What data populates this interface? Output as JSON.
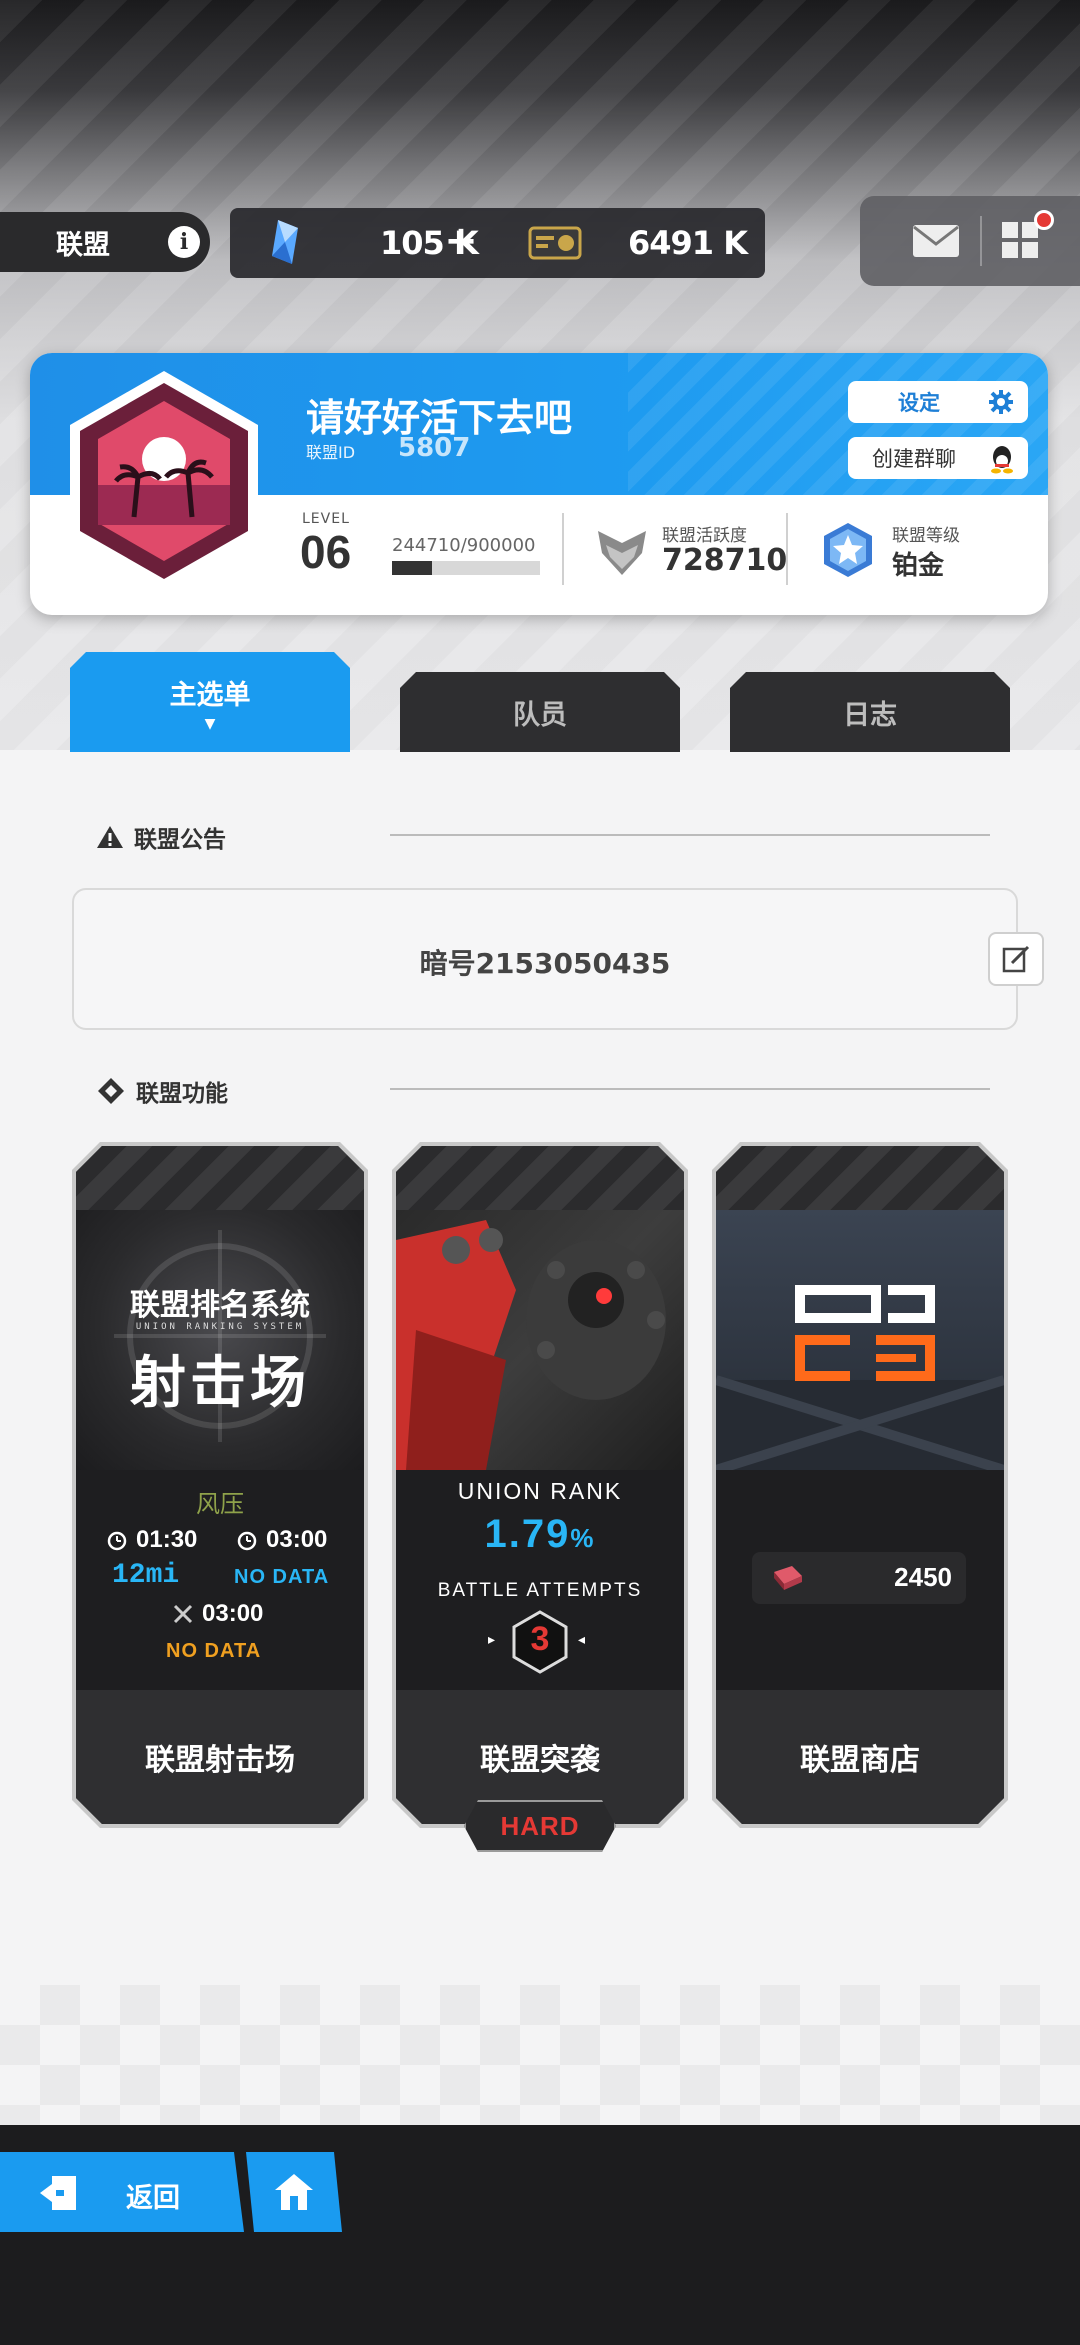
{
  "topbar": {
    "union_label": "联盟",
    "info_icon": "i",
    "crystal_value": "105 K",
    "plus_label": "+",
    "ticket_value": "6491 K"
  },
  "union": {
    "name": "请好好活下去吧",
    "id_label": "联盟ID",
    "id_value": "5807",
    "settings_label": "设定",
    "group_chat_label": "创建群聊",
    "level_label": "LEVEL",
    "level_value": "06",
    "exp_text": "244710/900000",
    "exp_fraction": 0.272,
    "activity_label": "联盟活跃度",
    "activity_value": "728710",
    "grade_label": "联盟等级",
    "grade_value": "铂金"
  },
  "tabs": [
    {
      "label": "主选单",
      "caret": "▼"
    },
    {
      "label": "队员"
    },
    {
      "label": "日志"
    }
  ],
  "notice": {
    "title": "联盟公告",
    "text": "暗号2153050435"
  },
  "functions": {
    "title": "联盟功能",
    "range": {
      "art_title": "联盟排名系统",
      "art_sub": "UNION RANKING SYSTEM",
      "art_big": "射击场",
      "boss": "风压",
      "time1": "01:30",
      "time2": "03:00",
      "glitch": "12mi",
      "nodata1": "NO DATA",
      "time3": "03:00",
      "nodata2": "NO DATA",
      "label": "联盟射击场"
    },
    "raid": {
      "rank_title": "UNION RANK",
      "rank_value": "1.79",
      "rank_unit": "%",
      "attempts_label": "BATTLE ATTEMPTS",
      "attempts_value": "3",
      "label": "联盟突袭",
      "difficulty": "HARD"
    },
    "shop": {
      "currency_value": "2450",
      "label": "联盟商店"
    }
  },
  "bottom": {
    "back_label": "返回"
  },
  "colors": {
    "accent_blue": "#1a9bf0",
    "dark": "#2b2b2d",
    "alert_red": "#e53935",
    "data_blue": "#29b6f6",
    "data_orange": "#f0a020"
  }
}
